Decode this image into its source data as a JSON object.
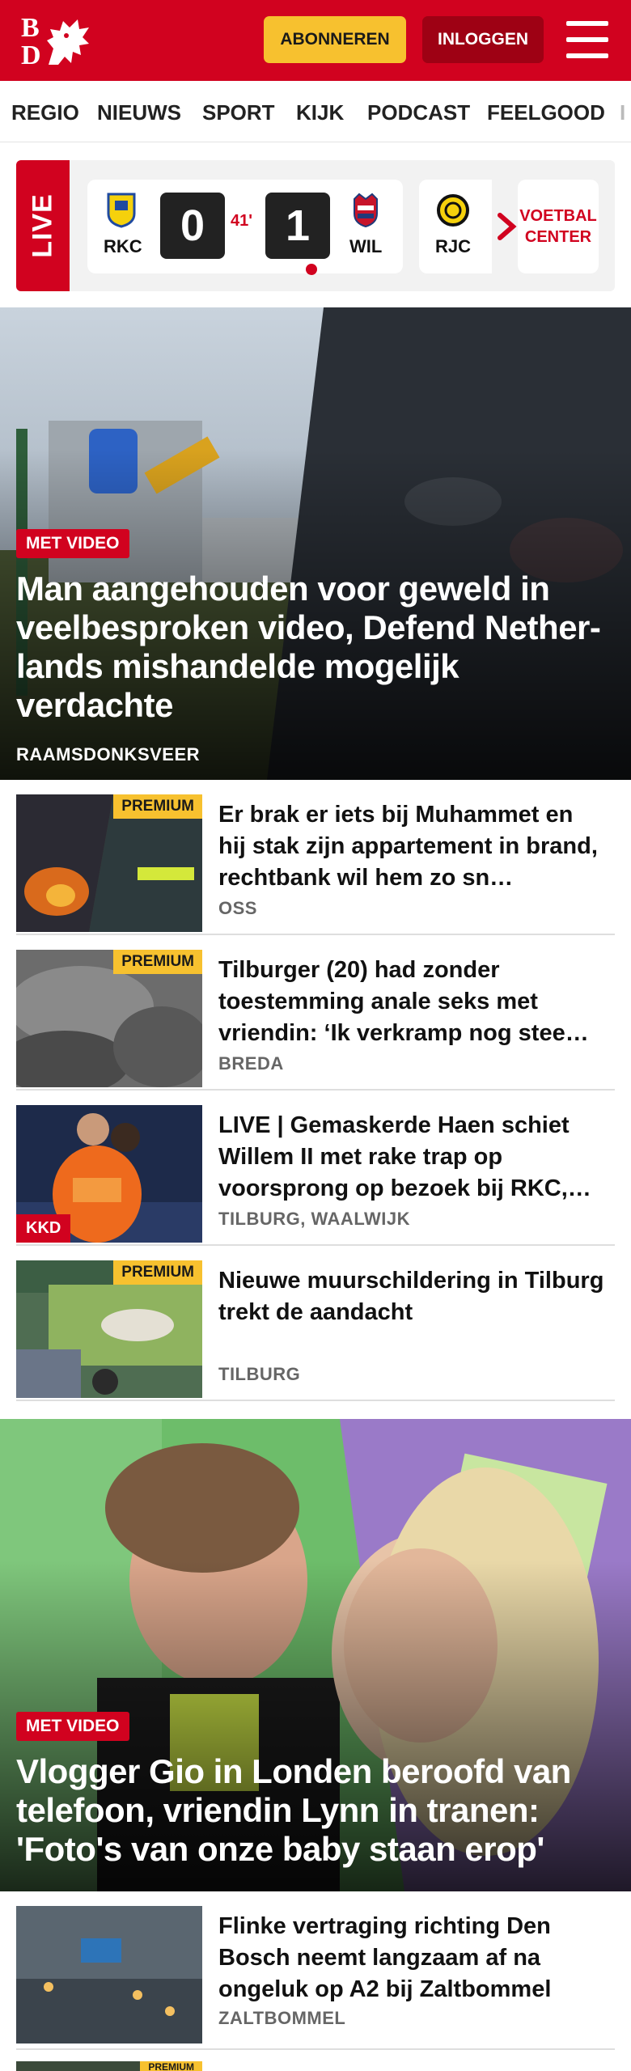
{
  "header": {
    "logo_letters": [
      "B",
      "D"
    ],
    "subscribe_label": "ABONNEREN",
    "login_label": "INLOGGEN",
    "menu_icon": "hamburger-icon"
  },
  "nav": {
    "items": [
      "REGIO",
      "NIEUWS",
      "SPORT",
      "KIJK",
      "PODCAST",
      "FEELGOOD",
      "I"
    ]
  },
  "live": {
    "label": "LIVE",
    "match": {
      "home": "RKC",
      "away": "WIL",
      "home_score": "0",
      "away_score": "1",
      "minute": "41'"
    },
    "next_club": "RJC",
    "center_label_line1": "VOETBAL",
    "center_label_line2": "CENTER"
  },
  "hero1": {
    "tag": "MET VIDEO",
    "title": "Man aangehouden voor geweld in veelbesproken video, Defend Nether-lands mishandelde mogelijk verdachte",
    "location": "RAAMSDONKSVEER"
  },
  "articles": [
    {
      "badge": "PREMIUM",
      "title": "Er brak er iets bij Muhammet en hij stak zijn appartement in brand, rechtbank wil hem zo sn…",
      "location": "OSS"
    },
    {
      "badge": "PREMIUM",
      "title": "Tilburger (20) had zonder toestemming anale seks met vriendin: ‘Ik verkramp nog stee…",
      "location": "BREDA"
    },
    {
      "badge": "KKD",
      "title": "LIVE | Gemaskerde Haen schiet Willem II met rake trap op voorsprong op bezoek bij RKC,…",
      "location": "TILBURG, WAALWIJK"
    },
    {
      "badge": "PREMIUM",
      "title": "Nieuwe muurschildering in Tilburg trekt de aandacht",
      "location": "TILBURG"
    }
  ],
  "hero2": {
    "tag": "MET VIDEO",
    "title": "Vlogger Gio in Londen beroofd van telefoon, vriendin Lynn in tranen: 'Foto's van onze baby staan erop'"
  },
  "articles2": [
    {
      "title": "Flinke vertraging richting Den Bosch neemt langzaam af na ongeluk op A2 bij Zaltbommel",
      "location": "ZALTBOMMEL"
    },
    {
      "badge": "PREMIUM"
    }
  ],
  "colors": {
    "brand_red": "#d1021f",
    "premium_yellow": "#f7c12f",
    "dark_red": "#9e0114"
  }
}
